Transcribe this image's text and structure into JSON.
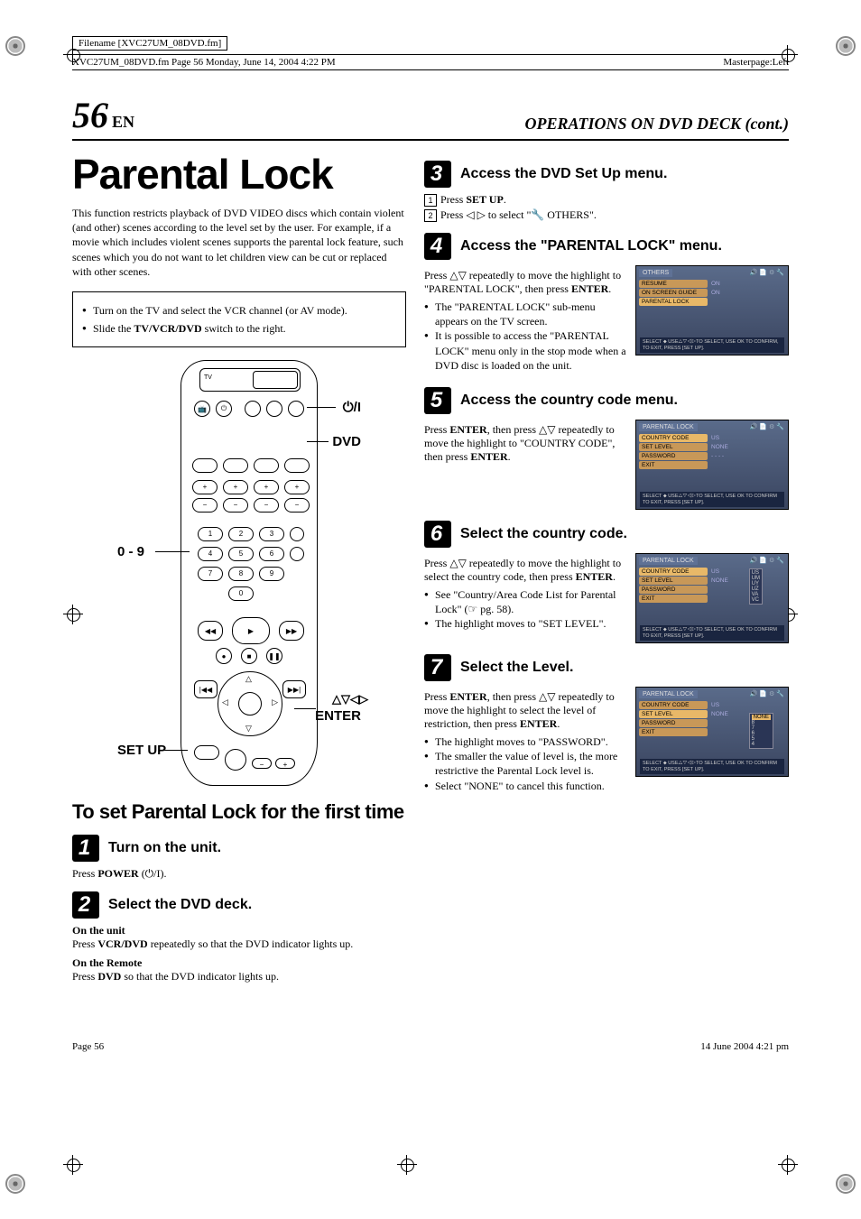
{
  "meta": {
    "filename": "Filename [XVC27UM_08DVD.fm]",
    "pageinfo_left": "XVC27UM_08DVD.fm  Page 56  Monday, June 14, 2004  4:22 PM",
    "masterpage": "Masterpage:Left"
  },
  "header": {
    "page_number": "56",
    "lang": "EN",
    "section": "OPERATIONS ON DVD DECK (cont.)"
  },
  "left": {
    "title": "Parental Lock",
    "intro": "This function restricts playback of DVD VIDEO discs which contain violent (and other) scenes according to the level set by the user. For example, if a movie which includes violent scenes supports the parental lock feature, such scenes which you do not want to let children view can be cut or replaced with other scenes.",
    "prep": [
      "Turn on the TV and select the VCR channel (or AV mode).",
      "Slide the TV/VCR/DVD switch to the right."
    ],
    "prep_bold1": "TV/VCR/DVD",
    "remote_labels": {
      "power": "⏻/I",
      "dvd": "DVD",
      "numbers": "0 - 9",
      "arrows": "△▽◁▷",
      "enter": "ENTER",
      "setup": "SET UP"
    },
    "subhead": "To set Parental Lock for the first time",
    "step1_title": "Turn on the unit.",
    "step1_body_a": "Press ",
    "step1_body_b": "POWER",
    "step1_body_c": " (⏻/I).",
    "step2_title": "Select the DVD deck.",
    "step2_unit_head": "On the unit",
    "step2_unit_a": "Press ",
    "step2_unit_b": "VCR/DVD",
    "step2_unit_c": " repeatedly so that the DVD indicator lights up.",
    "step2_remote_head": "On the Remote",
    "step2_remote_a": "Press ",
    "step2_remote_b": "DVD",
    "step2_remote_c": " so that the DVD indicator lights up."
  },
  "right": {
    "step3_title": "Access the DVD Set Up menu.",
    "step3_sub1_a": "Press ",
    "step3_sub1_b": "SET UP",
    "step3_sub1_c": ".",
    "step3_sub2_a": "Press ◁ ▷ to select \"",
    "step3_sub2_b": "🔧 OTHERS\".",
    "step4_title": "Access the \"PARENTAL LOCK\" menu.",
    "step4_text_a": "Press △▽ repeatedly to move the highlight to \"PARENTAL LOCK\", then press ",
    "step4_text_b": "ENTER",
    "step4_text_c": ".",
    "step4_bullets": [
      "The \"PARENTAL LOCK\" sub-menu appears on the TV screen.",
      "It is possible to access the \"PARENTAL LOCK\" menu only in the stop mode when a DVD disc is loaded on the unit."
    ],
    "step5_title": "Access the country code menu.",
    "step5_a": "Press ",
    "step5_b": "ENTER",
    "step5_c": ", then press △▽ repeatedly to move the highlight to \"COUNTRY CODE\", then press ",
    "step5_d": "ENTER",
    "step5_e": ".",
    "step6_title": "Select the country code.",
    "step6_a": "Press △▽ repeatedly to move the highlight to select the country code, then press ",
    "step6_b": "ENTER",
    "step6_c": ".",
    "step6_bullets_a": "See \"Country/Area Code List for Parental Lock\" (☞ pg. 58).",
    "step6_bullets_b": "The highlight moves to \"SET LEVEL\".",
    "step7_title": "Select the Level.",
    "step7_a": "Press ",
    "step7_b": "ENTER",
    "step7_c": ", then press △▽ repeatedly to move the highlight to select the level of restriction, then press ",
    "step7_d": "ENTER",
    "step7_e": ".",
    "step7_bullets": [
      "The highlight moves to \"PASSWORD\".",
      "The smaller the value of level is, the more restrictive the Parental Lock level is.",
      "Select \"NONE\" to cancel this function."
    ]
  },
  "osd": {
    "others": {
      "title": "OTHERS",
      "rows": [
        {
          "label": "RESUME",
          "val": "ON"
        },
        {
          "label": "ON SCREEN GUIDE",
          "val": "ON"
        },
        {
          "label": "PARENTAL LOCK",
          "val": ""
        }
      ],
      "footer": "SELECT ⬥ USE△▽◁▷TO SELECT, USE OK TO CONFIRM, TO EXIT, PRESS [SET UP]."
    },
    "plock": {
      "title": "PARENTAL LOCK",
      "rows": [
        {
          "label": "COUNTRY CODE",
          "val": "US"
        },
        {
          "label": "SET LEVEL",
          "val": "NONE"
        },
        {
          "label": "PASSWORD",
          "val": "- - - -"
        },
        {
          "label": "EXIT",
          "val": ""
        }
      ],
      "footer": "SELECT ⬥ USE△▽◁▷TO SELECT, USE OK TO CONFIRM TO EXIT, PRESS [SET UP]."
    },
    "codes": [
      "US",
      "UM",
      "UY",
      "UZ",
      "VA",
      "VC"
    ],
    "levels": [
      "NONE",
      "8",
      "7",
      "6",
      "5",
      "4"
    ]
  },
  "footer": {
    "left": "Page 56",
    "right": "14 June 2004 4:21 pm"
  }
}
